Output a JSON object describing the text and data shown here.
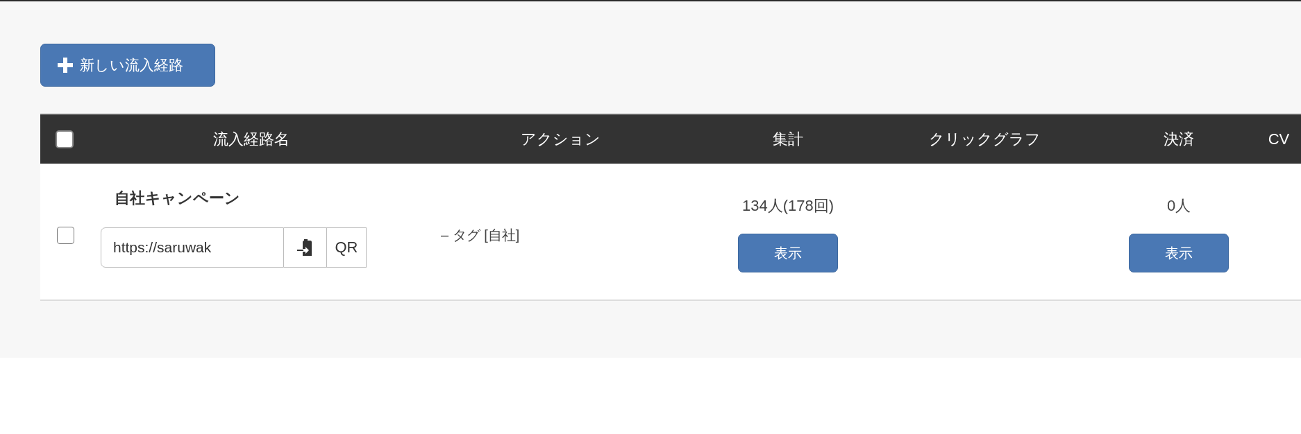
{
  "toolbar": {
    "new_button": {
      "label": "新しい流入経路"
    }
  },
  "table": {
    "select_all": {
      "checked": false
    },
    "columns": [
      "流入経路名",
      "アクション",
      "集計",
      "クリックグラフ",
      "決済",
      "CV"
    ],
    "rows": [
      {
        "checked": false,
        "name": "自社キャンペーン",
        "url": "https://saruwak",
        "qr_label": "QR",
        "action": "– タグ [自社]",
        "total": "134人(178回)",
        "total_button": "表示",
        "payment": "0人",
        "payment_button": "表示"
      }
    ]
  }
}
